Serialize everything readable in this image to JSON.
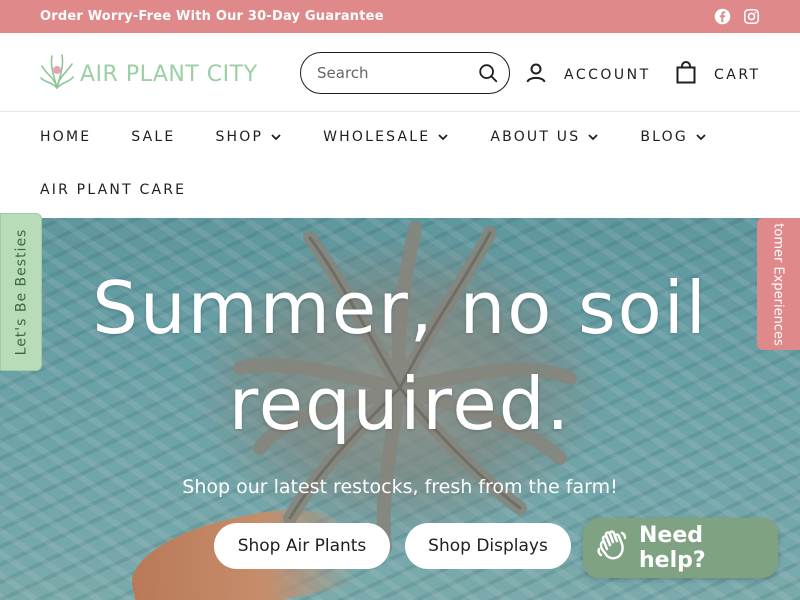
{
  "announcement": {
    "text": "Order Worry-Free With Our 30-Day Guarantee",
    "social": [
      {
        "icon": "facebook-icon"
      },
      {
        "icon": "instagram-icon"
      }
    ]
  },
  "header": {
    "logo_text": "AIR PLANT CITY",
    "search_placeholder": "Search",
    "account_label": "ACCOUNT",
    "cart_label": "CART"
  },
  "nav": {
    "row1": [
      {
        "label": "HOME",
        "has_dropdown": false
      },
      {
        "label": "SALE",
        "has_dropdown": false
      },
      {
        "label": "SHOP",
        "has_dropdown": true
      },
      {
        "label": "WHOLESALE",
        "has_dropdown": true
      },
      {
        "label": "ABOUT US",
        "has_dropdown": true
      },
      {
        "label": "BLOG",
        "has_dropdown": true
      }
    ],
    "row2": [
      {
        "label": "AIR PLANT CARE",
        "has_dropdown": false
      }
    ]
  },
  "hero": {
    "headline_line1": "Summer, no soil",
    "headline_line2": "required.",
    "subline": "Shop our latest restocks, fresh from the farm!",
    "button_primary": "Shop Air Plants",
    "button_secondary": "Shop Displays"
  },
  "side_tabs": {
    "left": "Let's Be Besties",
    "right": "tomer Experiences"
  },
  "chat": {
    "label": "Need help?"
  },
  "colors": {
    "announcement_bg": "#e0898a",
    "logo_green": "#9ccfa3",
    "chat_bg": "#7fa382"
  }
}
